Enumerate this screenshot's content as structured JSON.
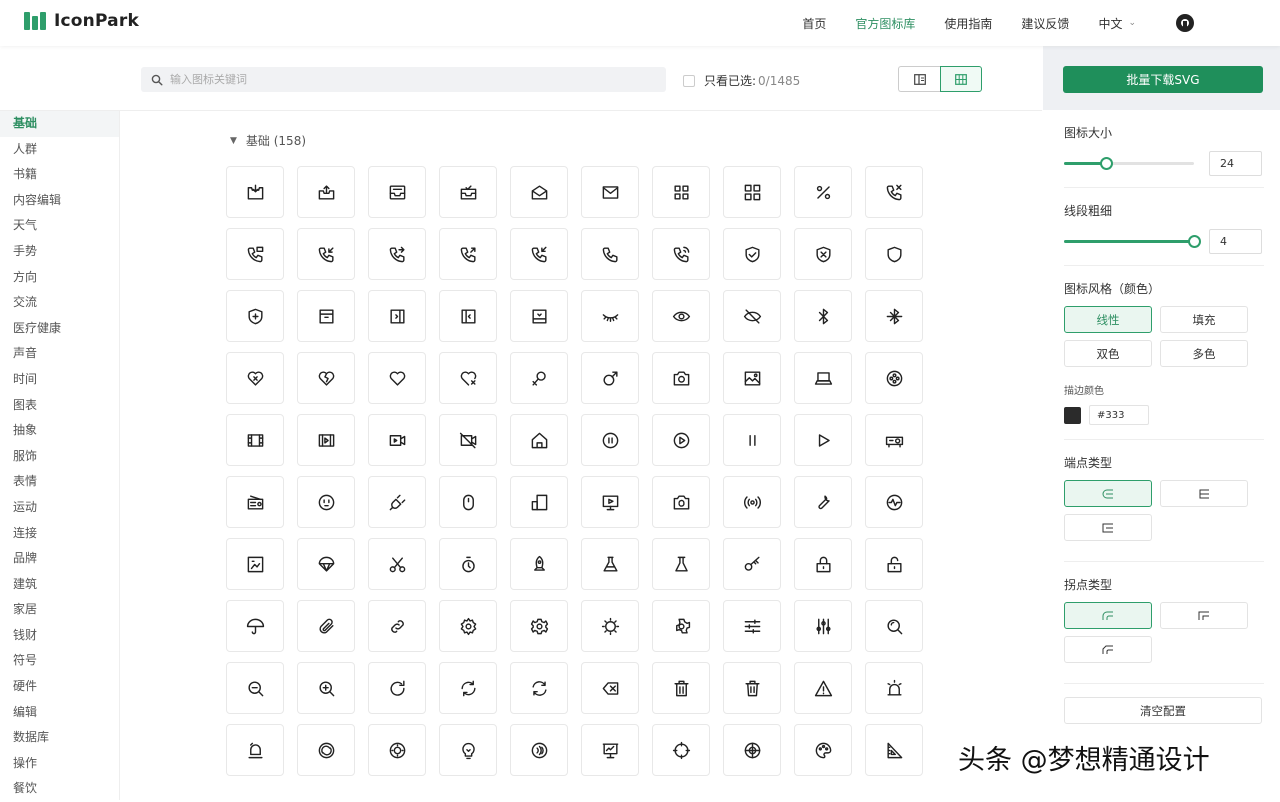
{
  "brand": {
    "name": "IconPark"
  },
  "nav": {
    "items": [
      "首页",
      "官方图标库",
      "使用指南",
      "建议反馈"
    ],
    "active": 1,
    "language": "中文"
  },
  "search": {
    "placeholder": "输入图标关键词"
  },
  "filter": {
    "selected_only_label": "只看已选:",
    "selected_count": "0/1485"
  },
  "sidebar": {
    "items": [
      "基础",
      "人群",
      "书籍",
      "内容编辑",
      "天气",
      "手势",
      "方向",
      "交流",
      "医疗健康",
      "声音",
      "时间",
      "图表",
      "抽象",
      "服饰",
      "表情",
      "运动",
      "连接",
      "品牌",
      "建筑",
      "家居",
      "钱财",
      "符号",
      "硬件",
      "编辑",
      "数据库",
      "操作",
      "餐饮"
    ],
    "active": 0
  },
  "section": {
    "title": "基础 (158)"
  },
  "icons": [
    "inbox-in-icon",
    "inbox-out-icon",
    "inbox-icon",
    "inbox-success-icon",
    "envelope-open-icon",
    "mail-icon",
    "apps-icon",
    "all-application-icon",
    "percentage-icon",
    "phone-missed-icon",
    "phone-message-icon",
    "phone-incoming-icon",
    "phone-outgoing-icon",
    "phone-forward-icon",
    "phone-received-icon",
    "phone-icon",
    "phone-call-icon",
    "shield-check-icon",
    "shield-x-icon",
    "shield-icon",
    "shield-plus-icon",
    "archive-icon",
    "panel-right-icon",
    "panel-left-icon",
    "inbox-down-icon",
    "eye-closed-icon",
    "eye-icon",
    "eye-off-icon",
    "bluetooth-icon",
    "bluetooth-off-icon",
    "heart-x-icon",
    "heart-broken-icon",
    "heart-icon",
    "heart-remove-icon",
    "female-icon",
    "male-icon",
    "camera-icon",
    "image-icon",
    "laptop-icon",
    "film-reel-icon",
    "film-icon",
    "video-frame-icon",
    "video-camera-icon",
    "video-off-icon",
    "home-icon",
    "pause-circle-icon",
    "play-circle-icon",
    "pause-icon",
    "play-icon",
    "projector-icon",
    "radio-icon",
    "power-outlet-icon",
    "plug-icon",
    "mouse-icon",
    "devices-icon",
    "monitor-play-icon",
    "camera-switch-icon",
    "broadcast-icon",
    "wrench-icon",
    "heartbeat-icon",
    "map-photo-icon",
    "parachute-icon",
    "scissors-icon",
    "stopwatch-icon",
    "rocket-icon",
    "flask-icon",
    "beaker-icon",
    "key-icon",
    "lock-icon",
    "unlock-icon",
    "umbrella-icon",
    "paperclip-icon",
    "link-icon",
    "settings-icon",
    "settings-gear-icon",
    "sun-icon",
    "gear-icon",
    "sliders-horizontal-icon",
    "sliders-vertical-icon",
    "search-icon",
    "zoom-out-icon",
    "zoom-in-icon",
    "redo-icon",
    "refresh-icon",
    "sync-icon",
    "backspace-icon",
    "trash-icon",
    "delete-icon",
    "warning-icon",
    "alarm-light-icon",
    "bell-ring-icon",
    "loop-icon",
    "dial-icon",
    "lightbulb-icon",
    "nfc-icon",
    "presentation-icon",
    "target-icon",
    "crosshair-icon",
    "palette-icon",
    "set-square-icon"
  ],
  "panel": {
    "download_label": "批量下载SVG",
    "size": {
      "label": "图标大小",
      "value": "24",
      "fraction": 0.33
    },
    "stroke": {
      "label": "线段粗细",
      "value": "4",
      "fraction": 1.0
    },
    "style": {
      "label": "图标风格（颜色）",
      "options": [
        "线性",
        "填充",
        "双色",
        "多色"
      ],
      "active": 0
    },
    "stroke_color": {
      "label": "描边颜色",
      "value": "#333",
      "swatch": "#2b2b2b"
    },
    "line_cap": {
      "label": "端点类型",
      "active": 0
    },
    "line_join": {
      "label": "拐点类型",
      "active": 0
    },
    "clear_label": "清空配置"
  },
  "watermark": "头条 @梦想精通设计",
  "colors": {
    "accent": "#2e9e6b",
    "accent_text": "#2e8f62"
  }
}
